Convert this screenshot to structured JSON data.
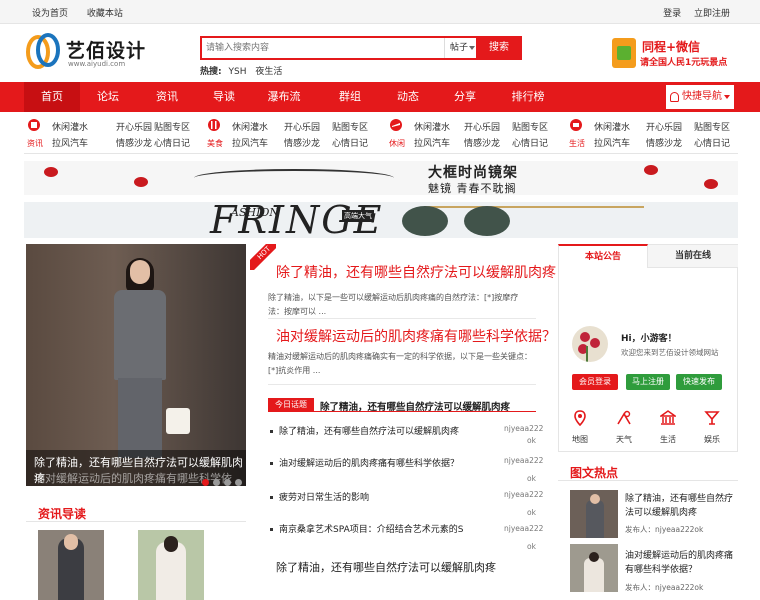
{
  "topbar": {
    "set_home": "设为首页",
    "bookmark": "收藏本站",
    "login": "登录",
    "register": "立即注册"
  },
  "logo": {
    "name": "艺佰设计",
    "url": "www.aiyudi.com"
  },
  "search": {
    "placeholder": "请输入搜索内容",
    "category": "帖子",
    "button": "搜索",
    "hot_label": "热搜:",
    "hot": [
      "YSH",
      "夜生活"
    ]
  },
  "promo": {
    "line1": "同程+微信",
    "line2": "请全国人民1元玩景点"
  },
  "nav": {
    "items": [
      "首页",
      "论坛",
      "资讯",
      "导读",
      "瀑布流",
      "群组",
      "动态",
      "分享",
      "排行榜"
    ],
    "quick": "快捷导航"
  },
  "subnav": [
    {
      "label": "资讯",
      "links": [
        "休闲灌水",
        "开心乐园",
        "贴图专区",
        "拉风汽车",
        "情感沙龙",
        "心情日记"
      ]
    },
    {
      "label": "美食",
      "links": [
        "休闲灌水",
        "开心乐园",
        "贴图专区",
        "拉风汽车",
        "情感沙龙",
        "心情日记"
      ]
    },
    {
      "label": "休闲",
      "links": [
        "休闲灌水",
        "开心乐园",
        "贴图专区",
        "拉风汽车",
        "情感沙龙",
        "心情日记"
      ]
    },
    {
      "label": "生活",
      "links": [
        "休闲灌水",
        "开心乐园",
        "贴图专区",
        "拉风汽车",
        "情感沙龙",
        "心情日记"
      ]
    }
  ],
  "banner1": {
    "title": "大框时尚镜架",
    "sub": "魅镜 青春不耽搁"
  },
  "banner2": {
    "big": "FRINGE",
    "small": "ASHION",
    "tag": "高端大气"
  },
  "slider": {
    "caption": "除了精油，还有哪些自然疗法可以缓解肌肉疼",
    "caption2": "油对缓解运动后的肌肉疼痛有哪些科学依据？"
  },
  "hot_badge": "HOT",
  "articles": [
    {
      "title": "除了精油，还有哪些自然疗法可以缓解肌肉疼",
      "summary": "除了精油，以下是一些可以缓解运动后肌肉疼痛的自然疗法：[*]按摩疗法：按摩可以 ..."
    },
    {
      "title": "油对缓解运动后的肌肉疼痛有哪些科学依据？",
      "summary": "精油对缓解运动后的肌肉疼痛确实有一定的科学依据，以下是一些关键点：[*]抗炎作用 ..."
    }
  ],
  "today": {
    "label": "今日话题",
    "title": "除了精油，还有哪些自然疗法可以缓解肌肉疼"
  },
  "list": [
    {
      "title": "除了精油，还有哪些自然疗法可以缓解肌肉疼",
      "user": "njyeaa222",
      "user2": "ok"
    },
    {
      "title": "油对缓解运动后的肌肉疼痛有哪些科学依据？",
      "user": "njyeaa222",
      "user2": "ok"
    },
    {
      "title": "疲劳对日常生活的影响",
      "user": "njyeaa222",
      "user2": "ok"
    },
    {
      "title": "南京桑拿艺术SPA项目：介绍结合艺术元素的S",
      "user": "njyeaa222",
      "user2": "ok"
    }
  ],
  "tail_title": "除了精油，还有哪些自然疗法可以缓解肌肉疼",
  "section_news": "资讯导读",
  "right": {
    "tab1": "本站公告",
    "tab2": "当前在线",
    "greet": "Hi，小游客！",
    "welcome": "欢迎您来到艺佰设计领域网站",
    "buttons": [
      "会员登录",
      "马上注册",
      "快速发布"
    ],
    "icons": [
      {
        "name": "map-icon",
        "label": "地图"
      },
      {
        "name": "weather-icon",
        "label": "天气"
      },
      {
        "name": "life-icon",
        "label": "生活"
      },
      {
        "name": "entertainment-icon",
        "label": "娱乐"
      }
    ],
    "hot_pics_title": "图文热点",
    "hot_pics": [
      {
        "title": "除了精油，还有哪些自然疗法可以缓解肌肉疼",
        "author": "发布人：njyeaa222ok"
      },
      {
        "title": "油对缓解运动后的肌肉疼痛有哪些科学依据？",
        "author": "发布人：njyeaa222ok"
      }
    ]
  },
  "colors": {
    "accent": "#e4191b",
    "nav_active": "#c70f12",
    "green": "#2f9c3c",
    "orange": "#f08519",
    "icon_red": "#e4191b"
  }
}
